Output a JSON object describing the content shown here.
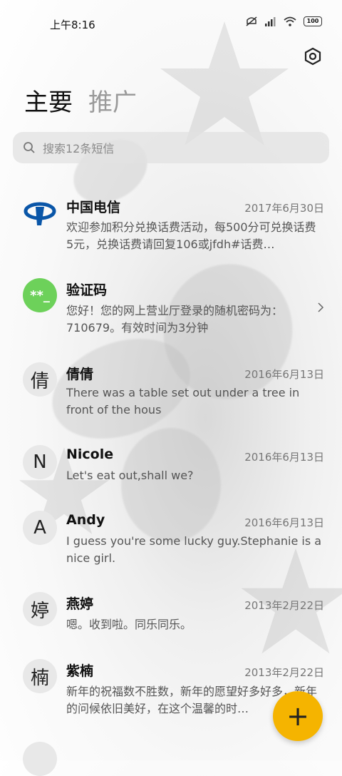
{
  "status": {
    "time": "上午8:16",
    "battery": "100"
  },
  "tabs": {
    "main": "主要",
    "promo": "推广"
  },
  "search": {
    "placeholder": "搜索12条短信"
  },
  "conversations": [
    {
      "name": "中国电信",
      "date": "2017年6月30日",
      "preview": "欢迎参加积分兑换话费活动，每500分可兑换话费5元，兑换话费请回复106或jfdh#话费…",
      "avatar": "telecom-logo"
    },
    {
      "name": "验证码",
      "date": "",
      "preview": "您好！您的网上营业厅登录的随机密码为：710679。有效时间为3分钟",
      "avatar_text": "**_"
    },
    {
      "name": "倩倩",
      "date": "2016年6月13日",
      "preview": "There was a table set out under a tree in front of the hous",
      "avatar_text": "倩"
    },
    {
      "name": "Nicole",
      "date": "2016年6月13日",
      "preview": "Let's eat out,shall we?",
      "avatar_text": "N"
    },
    {
      "name": "Andy",
      "date": "2016年6月13日",
      "preview": "I guess you're some lucky guy.Stephanie is a nice girl.",
      "avatar_text": "A"
    },
    {
      "name": "燕婷",
      "date": "2013年2月22日",
      "preview": "嗯。收到啦。同乐同乐。",
      "avatar_text": "婷"
    },
    {
      "name": "紫楠",
      "date": "2013年2月22日",
      "preview": "新年的祝福数不胜数，新年的愿望好多好多，新年的问候依旧美好，在这个温馨的时…",
      "avatar_text": "楠"
    }
  ],
  "colors": {
    "accent": "#f5b400",
    "verify_avatar": "#6dd15a",
    "telecom_blue": "#0a56a8"
  }
}
